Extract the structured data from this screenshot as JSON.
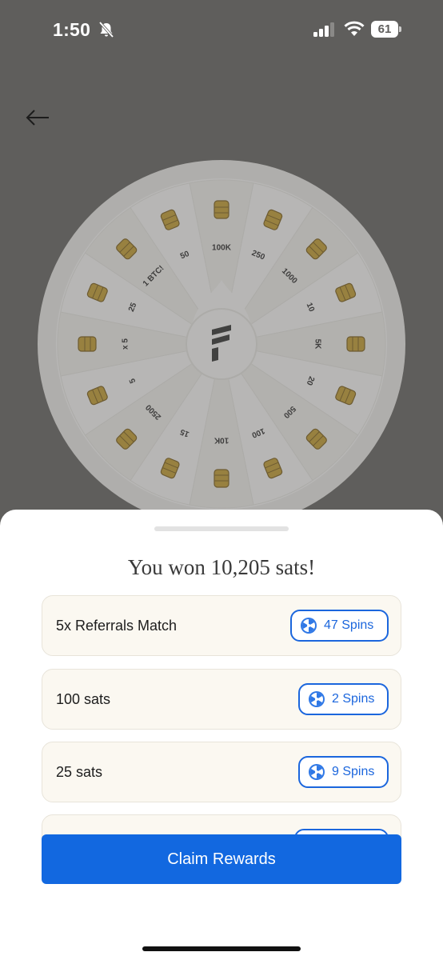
{
  "status_bar": {
    "time": "1:50",
    "battery": "61"
  },
  "wheel": {
    "segments": [
      "100K",
      "250",
      "1000",
      "10",
      "5K",
      "20",
      "500",
      "100",
      "10K",
      "15",
      "2500",
      "5",
      "x 5",
      "25",
      "1 BTC!",
      "50"
    ]
  },
  "sheet": {
    "title": "You won 10,205 sats!",
    "rewards": [
      {
        "label": "5x Referrals Match",
        "spins": "47 Spins"
      },
      {
        "label": "100 sats",
        "spins": "2 Spins"
      },
      {
        "label": "25 sats",
        "spins": "9 Spins"
      },
      {
        "label": "",
        "spins": ""
      }
    ],
    "claim_label": "Claim Rewards"
  },
  "colors": {
    "accent": "#1268e0",
    "overlay": "#5f5e5c",
    "coin": "#c79f2a"
  }
}
